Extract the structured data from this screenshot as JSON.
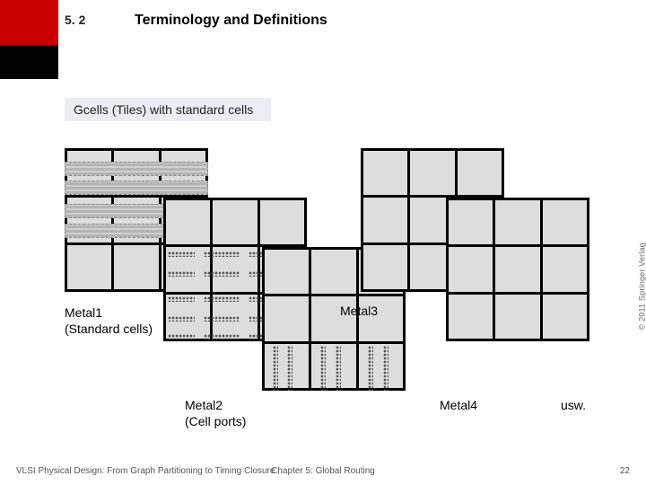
{
  "header": {
    "section_number": "5. 2",
    "title": "Terminology and Definitions"
  },
  "subtitle": "Gcells (Tiles) with standard cells",
  "labels": {
    "metal1_line1": "Metal1",
    "metal1_line2": "(Standard cells)",
    "metal2_line1": "Metal2",
    "metal2_line2": "(Cell ports)",
    "metal3": "Metal3",
    "metal4": "Metal4",
    "etc": "usw."
  },
  "copyright": "© 2011 Springer Verlag",
  "footer": {
    "left": "VLSI Physical Design: From Graph Partitioning to Timing Closure",
    "center": "Chapter 5: Global Routing",
    "pagenum": "22"
  }
}
